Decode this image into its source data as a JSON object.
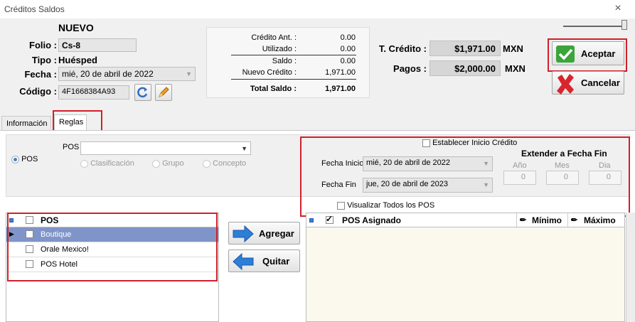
{
  "window": {
    "title": "Créditos Saldos",
    "close_glyph": "×"
  },
  "header": {
    "status": "NUEVO",
    "folio_label": "Folio :",
    "folio_value": "Cs-8",
    "tipo_label": "Tipo :",
    "tipo_value": "Huésped",
    "fecha_label": "Fecha :",
    "fecha_value": "mié, 20 de abril de 2022",
    "codigo_label": "Código :",
    "codigo_value": "4F1668384A93"
  },
  "summary": {
    "rows": [
      {
        "label": "Crédito Ant. :",
        "value": "0.00"
      },
      {
        "label": "Utilizado :",
        "value": "0.00"
      },
      {
        "label": "Saldo :",
        "value": "0.00"
      },
      {
        "label": "Nuevo Crédito :",
        "value": "1,971.00"
      },
      {
        "label": "Total Saldo :",
        "value": "1,971.00"
      }
    ]
  },
  "totals": {
    "credito_label": "T. Crédito :",
    "credito_value": "$1,971.00",
    "credito_currency": "MXN",
    "pagos_label": "Pagos :",
    "pagos_value": "$2,000.00",
    "pagos_currency": "MXN"
  },
  "actions": {
    "accept_label": "Aceptar",
    "cancel_label": "Cancelar"
  },
  "tabs": [
    {
      "label": "Información"
    },
    {
      "label": "Reglas"
    }
  ],
  "filters": {
    "pos_radio": "POS",
    "pos_label": "POS",
    "clasificacion": "Clasificación",
    "grupo": "Grupo",
    "concepto": "Concepto",
    "establecer": "Establecer Inicio Crédito",
    "fecha_inicio_label": "Fecha Inicio",
    "fecha_inicio_value": "mié, 20 de abril de 2022",
    "fecha_fin_label": "Fecha Fin",
    "fecha_fin_value": "jue, 20 de abril de 2023",
    "extender_label": "Extender a Fecha Fin",
    "anio_label": "Año",
    "anio_value": "0",
    "mes_label": "Mes",
    "mes_value": "0",
    "dia_label": "Dia",
    "dia_value": "0",
    "visualizar": "Visualizar Todos los POS"
  },
  "pos_grid": {
    "header": "POS",
    "rows": [
      {
        "name": "Boutique"
      },
      {
        "name": "Orale Mexico!"
      },
      {
        "name": "POS Hotel"
      }
    ]
  },
  "transfer": {
    "add_label": "Agregar",
    "remove_label": "Quitar"
  },
  "assigned_grid": {
    "header": "POS Asignado",
    "min_label": "Mínimo",
    "max_label": "Máximo"
  },
  "colors": {
    "highlight": "#d21f2a",
    "selected_row": "#7f95c9",
    "accept_green": "#3aa53a",
    "cancel_red": "#d7252b",
    "arrow_blue": "#2c7ed6"
  }
}
